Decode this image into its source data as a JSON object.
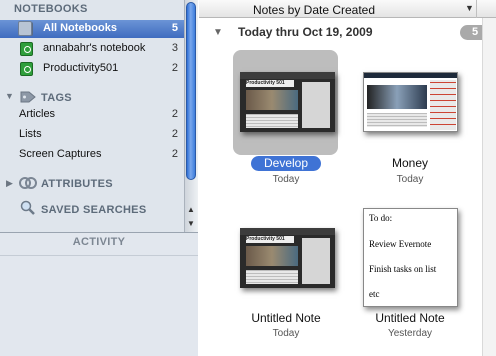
{
  "sidebar": {
    "notebooks_header": "NOTEBOOKS",
    "notebooks": [
      {
        "label": "All Notebooks",
        "count": "5",
        "selected": true
      },
      {
        "label": "annabahr's notebook",
        "count": "3"
      },
      {
        "label": "Productivity501",
        "count": "2"
      }
    ],
    "tags_header": "TAGS",
    "tags": [
      {
        "label": "Articles",
        "count": "2"
      },
      {
        "label": "Lists",
        "count": "2"
      },
      {
        "label": "Screen Captures",
        "count": "2"
      }
    ],
    "attributes_header": "ATTRIBUTES",
    "saved_searches_header": "SAVED SEARCHES",
    "activity_header": "ACTIVITY"
  },
  "main": {
    "sort_label": "Notes by Date Created",
    "group_title": "Today thru Oct 19, 2009",
    "group_count": "5",
    "notes": [
      {
        "title": "Develop",
        "date": "Today",
        "selected": true
      },
      {
        "title": "Money",
        "date": "Today"
      },
      {
        "title": "Untitled Note",
        "date": "Today"
      },
      {
        "title": "Untitled Note",
        "date": "Yesterday"
      }
    ],
    "thumb_text": {
      "blog_title": "Productivity 501",
      "todo_lines": [
        "To do:",
        "Review Evernote",
        "Finish tasks on list",
        "etc"
      ]
    }
  },
  "colors": {
    "selection": "#3f73d5",
    "sidebar_bg": "#dfe5ec",
    "header_text": "#5d6b7a"
  }
}
